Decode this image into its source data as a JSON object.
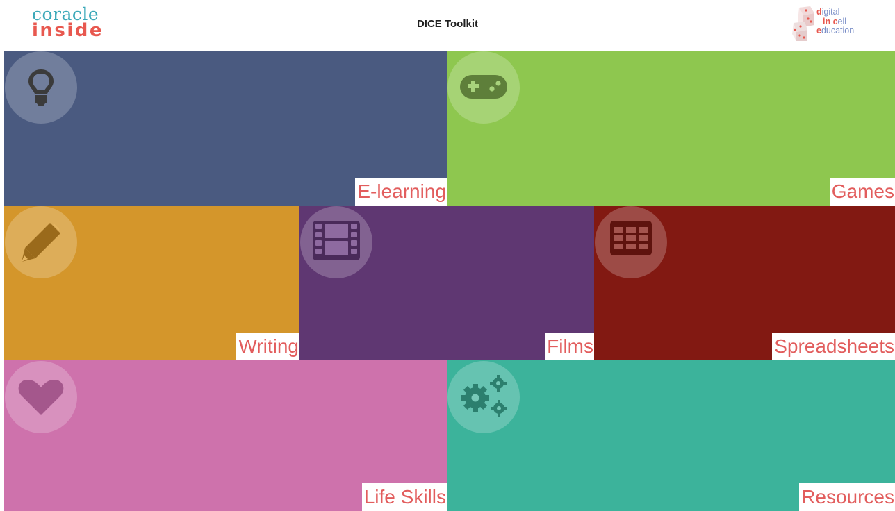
{
  "header": {
    "logo_left_line1": "coracle",
    "logo_left_line2": "inside",
    "title": "DICE Toolkit",
    "logo_right_line1_first": "d",
    "logo_right_line1_rest": "igital",
    "logo_right_line2_first": "in ",
    "logo_right_line2_c": "c",
    "logo_right_line2_rest": "ell",
    "logo_right_line3_first": "e",
    "logo_right_line3_rest": "ducation"
  },
  "tiles": [
    {
      "label": "E-learning",
      "color": "#4a5a80",
      "icon": "lightbulb-icon"
    },
    {
      "label": "Games",
      "color": "#8ec74f",
      "icon": "gamepad-icon"
    },
    {
      "label": "Writing",
      "color": "#d4962b",
      "icon": "pencil-icon"
    },
    {
      "label": "Films",
      "color": "#5f3772",
      "icon": "film-icon"
    },
    {
      "label": "Spreadsheets",
      "color": "#821912",
      "icon": "table-icon"
    },
    {
      "label": "Life Skills",
      "color": "#ce72ac",
      "icon": "heart-icon"
    },
    {
      "label": "Resources",
      "color": "#3cb39b",
      "icon": "gears-icon"
    }
  ],
  "colors": {
    "label_text": "#e25d5d",
    "accent_teal": "#3aa8b8",
    "accent_red": "#e8584f"
  }
}
